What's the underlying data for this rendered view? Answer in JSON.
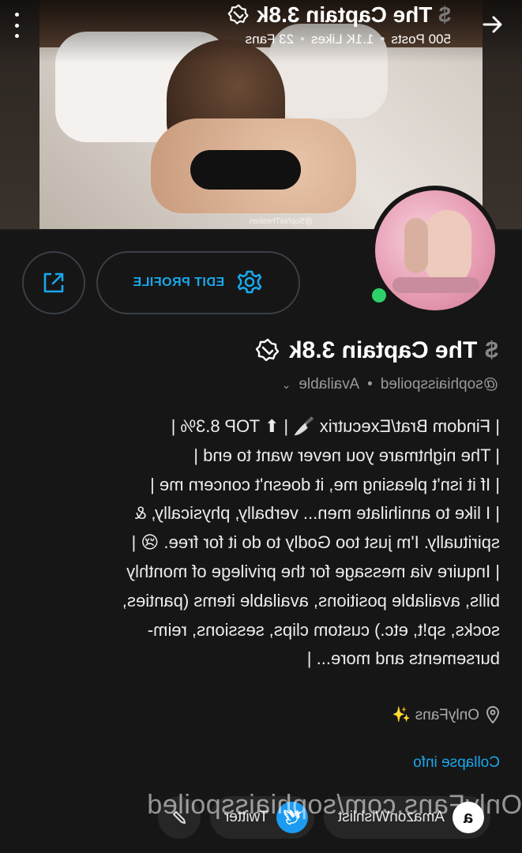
{
  "header": {
    "title": "The Captain 3.8k",
    "posts": "500 Posts",
    "likes": "1.1K Likes",
    "fans": "23 Fans",
    "separator": "•"
  },
  "cover": {
    "watermark": "@SophiaThesiren"
  },
  "profile": {
    "edit_label": "EDIT PROFILE",
    "name": "The Captain 3.8k",
    "dollar": "$",
    "handle": "@sophiaisspoiled",
    "separator": "•",
    "status": "Available",
    "status_chevron": "⌄"
  },
  "bio": {
    "lines": [
      "| Findom Brat/Executrix 🔪 | ⬆ TOP 8.3% |",
      "| The nightmare you never want to end |",
      "| If it isn't pleasing me, it doesn't concern me |",
      "| I like to annihilate men... verbally, physically, &",
      "spiritually. I'm just too Godly to do it for free. 😢 |",
      "| Inquire via message for the privilege of monthly",
      "bills, available positions, available items (panties,",
      "socks, sp!t, etc.) custom clips, sessions, reim-",
      "bursements and more... |"
    ],
    "location": "OnlyFans ✨",
    "collapse_label": "Collapse info"
  },
  "socials": {
    "amazon_label": "AmazonWishlist",
    "amazon_glyph": "a",
    "twitter_label": "Twitter",
    "twitter_glyph": "🕊"
  },
  "watermark_url": "OnlyFans.com/sophiaisspoiled",
  "colors": {
    "accent": "#1aa7ec",
    "online": "#2ed06a",
    "background": "#161616"
  }
}
